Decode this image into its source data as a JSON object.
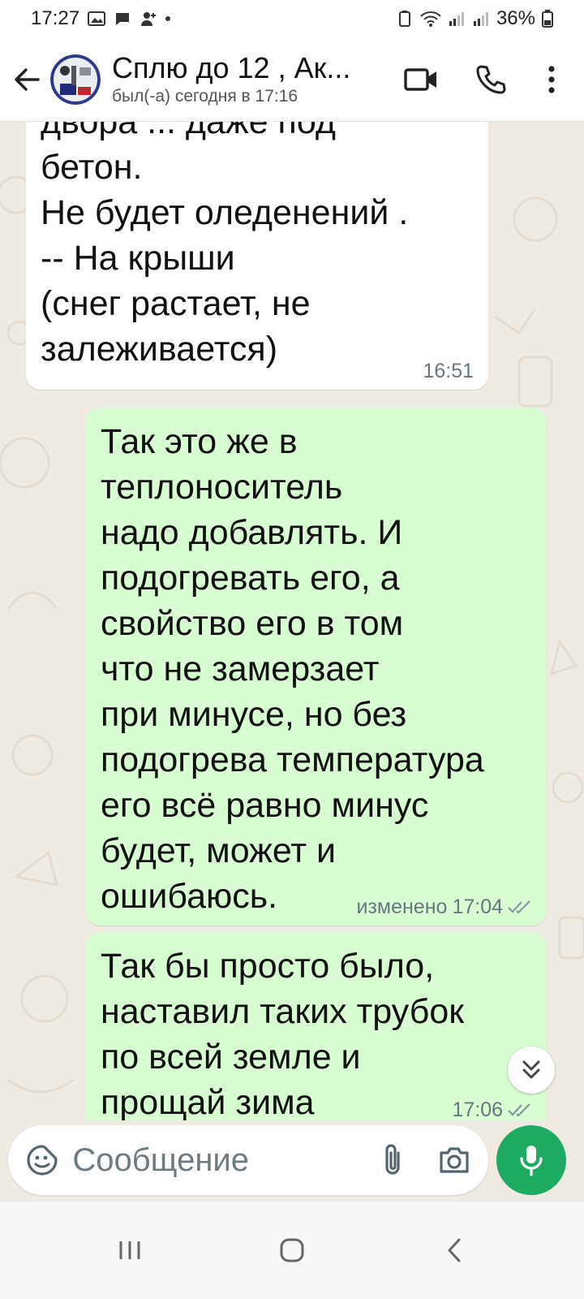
{
  "status_bar": {
    "time": "17:27",
    "battery": "36%"
  },
  "header": {
    "contact_name": "Сплю до 12 , Ак...",
    "last_seen": "был(-а) сегодня в 17:16",
    "icons": [
      "back-arrow-icon",
      "video-call-icon",
      "phone-icon",
      "more-vert-icon"
    ]
  },
  "messages": [
    {
      "direction": "incoming",
      "text": "двора ... даже под\nбетон.\nНе будет оледенений .\n-- На крыши\n(снег растает, не\nзалеживается)",
      "time": "16:51"
    },
    {
      "direction": "outgoing",
      "text": "Так это же в\nтеплоноситель\nнадо добавлять. И\nподогревать его, а\nсвойство его в том\nчто не замерзает\nпри минусе, но без\nподогрева температура\nего всё равно минус\nбудет, может и\nошибаюсь.",
      "edited_label": "изменено",
      "time": "17:04"
    },
    {
      "direction": "outgoing",
      "text": "Так бы просто было,\nнаставил таких трубок\nпо всей земле и\nпрощай зима",
      "time": "17:06"
    }
  ],
  "composer": {
    "placeholder": "Сообщение"
  },
  "colors": {
    "outgoing_bubble": "#d9fdd3",
    "incoming_bubble": "#ffffff",
    "accent_green": "#1daa61",
    "chat_background": "#efeae2",
    "read_ticks": "#8696a0"
  }
}
